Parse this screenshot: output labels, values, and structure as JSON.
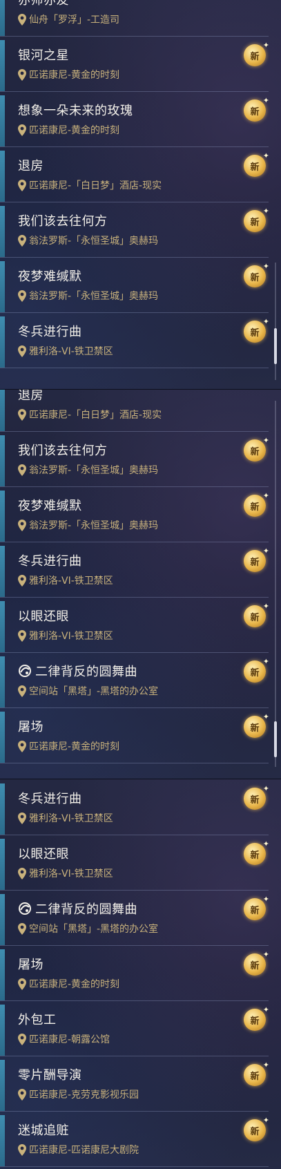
{
  "icons": {
    "location": "location-pin-icon",
    "new_badge": "new-badge-icon",
    "quest_glyph": "quest-glyph-icon"
  },
  "colors": {
    "accent": "#3f8db0",
    "location_text": "#c9b27c",
    "badge_gold": "#e9b64a"
  },
  "panels": [
    {
      "items": [
        {
          "title": "亦师亦友",
          "location": "仙舟「罗浮」-工造司"
        },
        {
          "title": "银河之星",
          "location": "匹诺康尼-黄金的时刻",
          "badge": "新"
        },
        {
          "title": "想象一朵未来的玫瑰",
          "location": "匹诺康尼-黄金的时刻",
          "badge": "新"
        },
        {
          "title": "退房",
          "location": "匹诺康尼-「白日梦」酒店-现实",
          "badge": "新"
        },
        {
          "title": "我们该去往何方",
          "location": "翁法罗斯-「永恒圣城」奥赫玛",
          "badge": "新"
        },
        {
          "title": "夜梦难缄默",
          "location": "翁法罗斯-「永恒圣城」奥赫玛",
          "badge": "新"
        },
        {
          "title": "冬兵进行曲",
          "location": "雅利洛-VI-铁卫禁区",
          "badge": "新"
        }
      ]
    },
    {
      "items": [
        {
          "title": "退房",
          "location": "匹诺康尼-「白日梦」酒店-现实"
        },
        {
          "title": "我们该去往何方",
          "location": "翁法罗斯-「永恒圣城」奥赫玛",
          "badge": "新"
        },
        {
          "title": "夜梦难缄默",
          "location": "翁法罗斯-「永恒圣城」奥赫玛",
          "badge": "新"
        },
        {
          "title": "冬兵进行曲",
          "location": "雅利洛-VI-铁卫禁区",
          "badge": "新"
        },
        {
          "title": "以眼还眼",
          "location": "雅利洛-VI-铁卫禁区",
          "badge": "新"
        },
        {
          "title": "二律背反的圆舞曲",
          "location": "空间站「黑塔」-黑塔的办公室",
          "badge": "新"
        },
        {
          "title": "屠场",
          "location": "匹诺康尼-黄金的时刻",
          "badge": "新"
        }
      ]
    },
    {
      "items": [
        {
          "title": "冬兵进行曲",
          "location": "雅利洛-VI-铁卫禁区",
          "badge": "新"
        },
        {
          "title": "以眼还眼",
          "location": "雅利洛-VI-铁卫禁区",
          "badge": "新"
        },
        {
          "title": "二律背反的圆舞曲",
          "location": "空间站「黑塔」-黑塔的办公室",
          "badge": "新"
        },
        {
          "title": "屠场",
          "location": "匹诺康尼-黄金的时刻",
          "badge": "新"
        },
        {
          "title": "外包工",
          "location": "匹诺康尼-朝露公馆",
          "badge": "新"
        },
        {
          "title": "零片酬导演",
          "location": "匹诺康尼-克劳克影视乐园",
          "badge": "新"
        },
        {
          "title": "迷城追赃",
          "location": "匹诺康尼-匹诺康尼大剧院",
          "badge": "新"
        }
      ]
    }
  ]
}
